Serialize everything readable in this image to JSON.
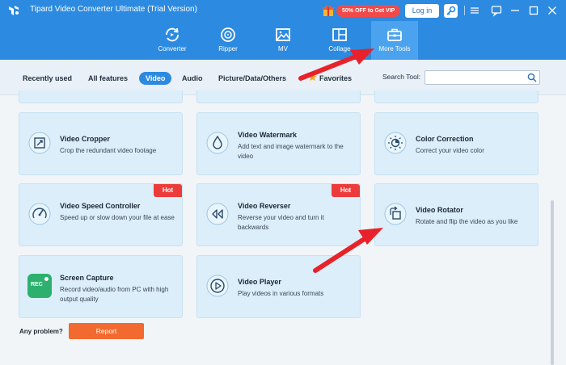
{
  "app": {
    "title": "Tipard Video Converter Ultimate (Trial Version)",
    "promo": "50% OFF to Get VIP",
    "login_label": "Log in"
  },
  "nav": [
    {
      "label": "Converter",
      "icon": "converter-icon"
    },
    {
      "label": "Ripper",
      "icon": "ripper-icon"
    },
    {
      "label": "MV",
      "icon": "mv-icon"
    },
    {
      "label": "Collage",
      "icon": "collage-icon"
    },
    {
      "label": "More Tools",
      "icon": "toolbox-icon",
      "active": true
    }
  ],
  "filters": {
    "tabs": [
      "Recently used",
      "All features",
      "Video",
      "Audio",
      "Picture/Data/Others",
      "Favorites"
    ],
    "active": "Video",
    "search_label": "Search Tool:",
    "search_value": ""
  },
  "cards": [
    {
      "title": "Video Cropper",
      "desc": "Crop the redundant video footage",
      "icon": "crop-icon"
    },
    {
      "title": "Video Watermark",
      "desc": "Add text and image watermark to the video",
      "icon": "watermark-drop-icon"
    },
    {
      "title": "Color Correction",
      "desc": "Correct your video color",
      "icon": "color-sun-icon"
    },
    {
      "title": "Video Speed Controller",
      "desc": "Speed up or slow down your file at ease",
      "icon": "speedometer-icon",
      "badge": "Hot"
    },
    {
      "title": "Video Reverser",
      "desc": "Reverse your video and turn it backwards",
      "icon": "rewind-icon",
      "badge": "Hot"
    },
    {
      "title": "Video Rotator",
      "desc": "Rotate and flip the video as you like",
      "icon": "rotate-icon"
    },
    {
      "title": "Screen Capture",
      "desc": "Record video/audio from PC with high output quality",
      "icon": "rec-icon",
      "icon_text": "REC"
    },
    {
      "title": "Video Player",
      "desc": "Play videos in various formats",
      "icon": "play-icon"
    }
  ],
  "footer": {
    "problem_text": "Any problem?",
    "report_label": "Report"
  },
  "colors": {
    "header": "#2c8ae0",
    "card": "#dbeefa",
    "hot": "#ed3b3b",
    "report": "#f26a2f",
    "arrow": "#e8222a"
  }
}
